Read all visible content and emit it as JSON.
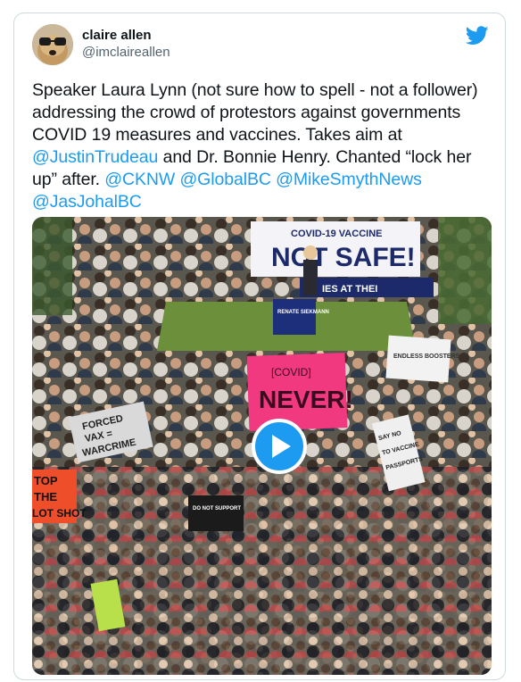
{
  "tweet": {
    "author": {
      "display_name": "claire allen",
      "handle": "@imclaireallen",
      "avatar_icon": "dog-avatar",
      "platform_icon": "twitter-bird-icon"
    },
    "text_parts": {
      "p1": "Speaker Laura Lynn (not sure how to spell - not a follower) addressing the crowd of protestors against governments COVID 19 measures and vaccines. Takes aim at ",
      "m1": "@JustinTrudeau",
      "p2": " and Dr. Bonnie Henry. Chanted “lock her up” after.  ",
      "m2": "@CKNW",
      "m3": "@GlobalBC",
      "m4": "@MikeSmythNews",
      "m5": "@JasJohalBC"
    },
    "media": {
      "type": "video",
      "play_icon": "play-icon",
      "signs": {
        "banner_top": "COVID-19 VACCINE",
        "banner_main": "NOT SAFE!",
        "banner_strip": "IES AT THEI",
        "renate": "RENATE SIEKMANN",
        "endless": "ENDLESS BOOSTERS",
        "covid": "[COVID]",
        "never": "NEVER!",
        "forced_1": "FORCED",
        "forced_2": "VAX =",
        "forced_3": "WARCRIME",
        "stop_1": "TOP",
        "stop_2": "THE",
        "stop_3": "LOT SHOT",
        "passports_1": "SAY NO",
        "passports_2": "TO VACCINE",
        "passports_3": "PASSPORTS",
        "support": "DO NOT SUPPORT"
      }
    }
  },
  "colors": {
    "link": "#1d9bf0",
    "text": "#0f1419",
    "secondary": "#536471",
    "sign_pink": "#f0397e"
  }
}
